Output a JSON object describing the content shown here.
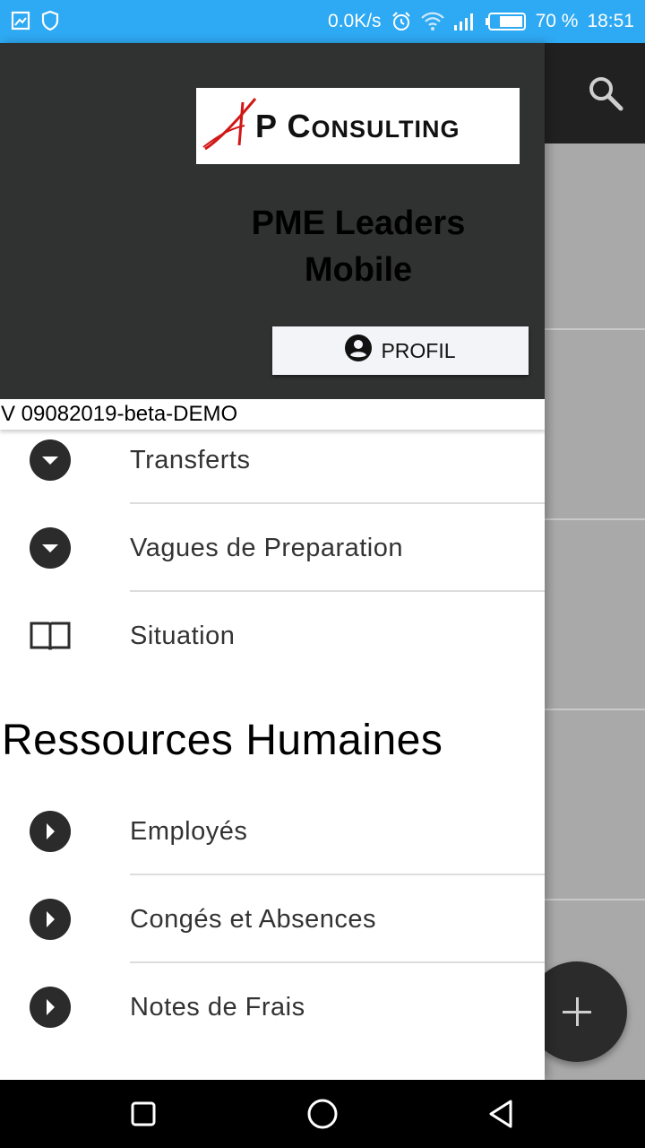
{
  "status_bar": {
    "network_speed": "0.0K/s",
    "battery": "70 %",
    "time": "18:51",
    "background_color": "#2ea9f3",
    "icons": [
      "gallery-icon",
      "shield-icon",
      "alarm-icon",
      "wifi-icon",
      "signal-icon",
      "battery-icon"
    ]
  },
  "app": {
    "toolbar_color": "#212121",
    "search_icon": "search-icon",
    "fab_icon": "plus-icon"
  },
  "drawer": {
    "logo_text": "AP CONSULTING",
    "app_name_line1": "PME Leaders",
    "app_name_line2": "Mobile",
    "profile_button": "PROFIL",
    "version": "V 09082019-beta-DEMO",
    "items": [
      {
        "label": "Transferts",
        "icon": "caret-down-circle-icon"
      },
      {
        "label": "Vagues de Preparation",
        "icon": "caret-down-circle-icon"
      },
      {
        "label": "Situation",
        "icon": "open-book-icon"
      }
    ],
    "section_title": "Ressources Humaines",
    "hr_items": [
      {
        "label": "Employés",
        "icon": "play-circle-icon"
      },
      {
        "label": "Congés et Absences",
        "icon": "play-circle-icon"
      },
      {
        "label": "Notes de Frais",
        "icon": "play-circle-icon"
      }
    ]
  },
  "nav_bar": {
    "buttons": [
      "recent-apps-icon",
      "home-icon",
      "back-icon"
    ]
  }
}
